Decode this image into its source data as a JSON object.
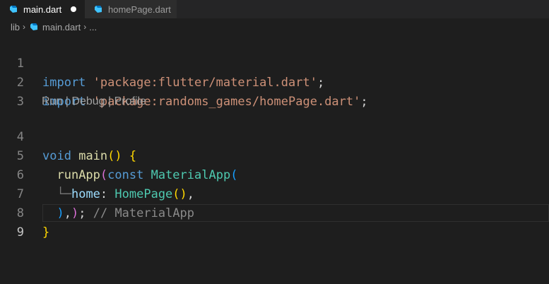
{
  "tabs": [
    {
      "label": "main.dart",
      "active": true,
      "modified": true
    },
    {
      "label": "homePage.dart",
      "active": false,
      "modified": false
    }
  ],
  "breadcrumb": {
    "folder": "lib",
    "file": "main.dart",
    "more": "..."
  },
  "codelens": "Run | Debug | Profile",
  "lines": [
    {
      "n": "1",
      "import_kw": "import",
      "path": "'package:flutter/material.dart'",
      "semi": ";"
    },
    {
      "n": "2",
      "import_kw": "import",
      "path": "'package:randoms_games/homePage.dart'",
      "semi": ";"
    },
    {
      "n": "3"
    },
    {
      "n": "4",
      "void": "void",
      "name": "main",
      "parens": "()",
      "brace": "{"
    },
    {
      "n": "5",
      "fn": "runApp",
      "open": "(",
      "const": "const",
      "cls": "MaterialApp",
      "open2": "("
    },
    {
      "n": "6",
      "guide": "└─",
      "prop": "home",
      "colon": ": ",
      "cls": "HomePage",
      "parens": "()",
      "comma": ","
    },
    {
      "n": "7",
      "close1": ")",
      "comma": ",",
      "close2": ")",
      "semi": ";",
      "comment": "// MaterialApp"
    },
    {
      "n": "8",
      "brace": "}"
    },
    {
      "n": "9"
    }
  ],
  "colors": {
    "background": "#1e1e1e",
    "keyword": "#569cd6",
    "string": "#ce9178",
    "function": "#dcdcaa",
    "class": "#4ec9b0"
  }
}
